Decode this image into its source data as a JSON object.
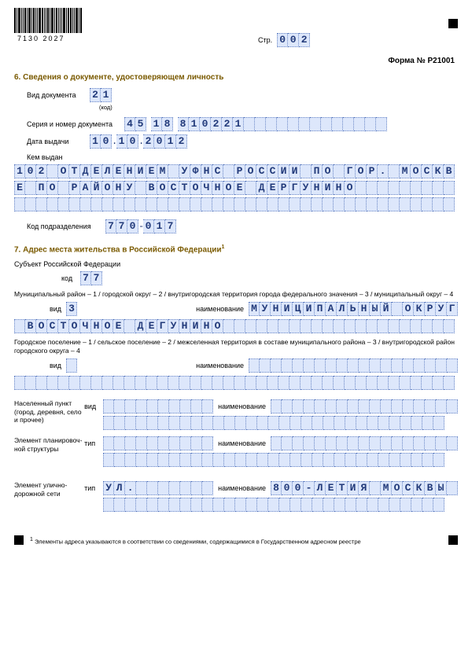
{
  "header": {
    "barcode_digits": "7130 2027",
    "page_label": "Стр.",
    "page_number": "002",
    "form_number": "Форма № Р21001"
  },
  "section6": {
    "title": "6. Сведения о документе, удостоверяющем личность",
    "doc_type": {
      "label": "Вид документа",
      "sub": "(код)",
      "value": "21"
    },
    "series": {
      "label": "Серия и номер документа",
      "p1": "45",
      "p2": "18",
      "p3": "810221"
    },
    "issue_date": {
      "label": "Дата выдачи",
      "d": "10",
      "m": "10",
      "y": "2012"
    },
    "issued_by": {
      "label": "Кем выдан",
      "line1": "102 ОТДЕЛЕНИЕМ УФНС РОССИИ ПО ГОР. МОСКВ",
      "line2": "Е ПО РАЙОНУ ВОСТОЧНОЕ ДЕРГУНИНО",
      "line3": ""
    },
    "dept_code": {
      "label": "Код подразделения",
      "p1": "770",
      "p2": "017"
    }
  },
  "section7": {
    "title": "7. Адрес места жительства в Российской Федерации",
    "subject": {
      "title": "Субъект Российской Федерации",
      "code_label": "код",
      "code": "77"
    },
    "mun_note": "Муниципальный район – 1 / городской округ – 2 / внутригородская территория города федерального значения – 3 / муниципальный округ – 4",
    "type_label": "вид",
    "name_label": "наименование",
    "tip_label": "тип",
    "mun": {
      "type": "3",
      "name_line1": "МУНИЦИПАЛЬНЫЙ ОКРУГ",
      "name_line2": " ВОСТОЧНОЕ ДЕГУНИНО"
    },
    "gor_note": "Городское поселение – 1 / сельское поселение – 2 / межселенная территория в составе муниципального района – 3 / внутригородской район городского округа – 4",
    "gor": {
      "type": "",
      "name_line1": "",
      "name_line2": ""
    },
    "np": {
      "label": "Населенный пункт (город, деревня, село и прочее)",
      "type": "",
      "name_line1": "",
      "name_line2": ""
    },
    "plan": {
      "label": "Элемент планировоч- ной структуры",
      "type": "",
      "name_line1": "",
      "name_line2": ""
    },
    "street": {
      "label": "Элемент улично- дорожной сети",
      "type": "УЛ.",
      "name_line1": "800-ЛЕТИЯ МОСКВЫ",
      "name_line2": ""
    }
  },
  "footnote": "Элементы адреса указываются в соответствии со сведениями, содержащимися в Государственном адресном реестре"
}
